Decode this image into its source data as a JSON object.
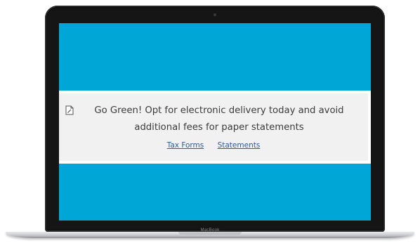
{
  "device": {
    "brand_label": "MacBook"
  },
  "colors": {
    "screen_background": "#00a6d6",
    "banner_background": "#f1f1f1",
    "message_text": "#3b3b3b",
    "link": "#2f5d8f"
  },
  "notice": {
    "icon": "document-edit-icon",
    "message": "Go Green! Opt for electronic delivery today and avoid additional fees for paper statements",
    "links": [
      {
        "label": "Tax Forms"
      },
      {
        "label": "Statements"
      }
    ]
  }
}
